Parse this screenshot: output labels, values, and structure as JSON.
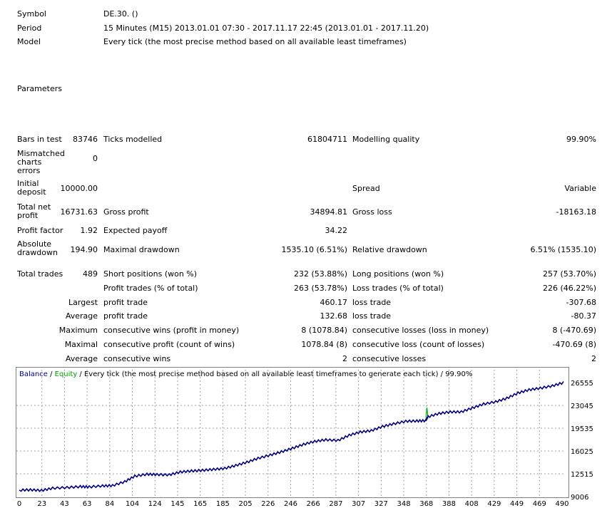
{
  "header": {
    "symbol_label": "Symbol",
    "symbol_value": "DE.30. ()",
    "period_label": "Period",
    "period_value": "15 Minutes (M15) 2013.01.01 07:30 - 2017.11.17 22:45 (2013.01.01 - 2017.11.20)",
    "model_label": "Model",
    "model_value": "Every tick (the most precise method based on all available least timeframes)",
    "parameters_label": "Parameters"
  },
  "stats": {
    "bars_label": "Bars in test",
    "bars_value": "83746",
    "ticks_label": "Ticks modelled",
    "ticks_value": "61804711",
    "quality_label": "Modelling quality",
    "quality_value": "99.90%",
    "mismatch_label": "Mismatched charts errors",
    "mismatch_value": "0",
    "deposit_label": "Initial deposit",
    "deposit_value": "10000.00",
    "spread_label": "Spread",
    "spread_value": "Variable",
    "netprofit_label": "Total net profit",
    "netprofit_value": "16731.63",
    "grossprofit_label": "Gross profit",
    "grossprofit_value": "34894.81",
    "grossloss_label": "Gross loss",
    "grossloss_value": "-18163.18",
    "pf_label": "Profit factor",
    "pf_value": "1.92",
    "payoff_label": "Expected payoff",
    "payoff_value": "34.22",
    "absdd_label": "Absolute drawdown",
    "absdd_value": "194.90",
    "maxdd_label": "Maximal drawdown",
    "maxdd_value": "1535.10 (6.51%)",
    "reldd_label": "Relative drawdown",
    "reldd_value": "6.51% (1535.10)",
    "trades_label": "Total trades",
    "trades_value": "489",
    "short_label": "Short positions (won %)",
    "short_value": "232 (53.88%)",
    "long_label": "Long positions (won %)",
    "long_value": "257 (53.70%)",
    "ptrades_label": "Profit trades (% of total)",
    "ptrades_value": "263 (53.78%)",
    "ltrades_label": "Loss trades (% of total)",
    "ltrades_value": "226 (46.22%)",
    "largest_label": "Largest",
    "largest_p_label": "profit trade",
    "largest_p_value": "460.17",
    "largest_l_label": "loss trade",
    "largest_l_value": "-307.68",
    "average_label": "Average",
    "average_p_label": "profit trade",
    "average_p_value": "132.68",
    "average_l_label": "loss trade",
    "average_l_value": "-80.37",
    "maximum_label": "Maximum",
    "maxwins_label": "consecutive wins (profit in money)",
    "maxwins_value": "8 (1078.84)",
    "maxlosses_label": "consecutive losses (loss in money)",
    "maxlosses_value": "8 (-470.69)",
    "maximal_label": "Maximal",
    "maxprofit_label": "consecutive profit (count of wins)",
    "maxprofit_value": "1078.84 (8)",
    "maxloss_label": "consecutive loss (count of losses)",
    "maxloss_value": "-470.69 (8)",
    "avgcons_label": "Average",
    "avgwins_label": "consecutive wins",
    "avgwins_value": "2",
    "avglosses_label": "consecutive losses",
    "avglosses_value": "2"
  },
  "chart_legend": {
    "balance": "Balance",
    "slash": " / ",
    "equity": "Equity",
    "rest": " / Every tick (the most precise method based on all available least timeframes to generate each tick) / 99.90%",
    "balance_color": "#000080",
    "equity_color": "#00b000"
  },
  "chart_data": {
    "type": "line",
    "x_ticks": [
      "0",
      "23",
      "43",
      "63",
      "84",
      "104",
      "124",
      "145",
      "165",
      "185",
      "205",
      "226",
      "246",
      "266",
      "287",
      "307",
      "327",
      "348",
      "368",
      "388",
      "408",
      "429",
      "449",
      "469",
      "490"
    ],
    "y_ticks": [
      "26555",
      "23045",
      "19535",
      "16025",
      "12515",
      "9006"
    ],
    "ylim": [
      9006,
      26555
    ],
    "xlim": [
      0,
      490
    ],
    "series": [
      {
        "name": "Balance",
        "values": [
          [
            0,
            10000
          ],
          [
            10,
            10050
          ],
          [
            20,
            9950
          ],
          [
            30,
            10300
          ],
          [
            43,
            10400
          ],
          [
            55,
            10550
          ],
          [
            63,
            10500
          ],
          [
            75,
            10650
          ],
          [
            84,
            10700
          ],
          [
            95,
            11300
          ],
          [
            104,
            12150
          ],
          [
            115,
            12450
          ],
          [
            124,
            12400
          ],
          [
            135,
            12350
          ],
          [
            145,
            12800
          ],
          [
            155,
            12950
          ],
          [
            165,
            13050
          ],
          [
            175,
            13200
          ],
          [
            185,
            13350
          ],
          [
            195,
            13800
          ],
          [
            205,
            14300
          ],
          [
            215,
            14900
          ],
          [
            226,
            15400
          ],
          [
            236,
            15900
          ],
          [
            246,
            16450
          ],
          [
            256,
            17050
          ],
          [
            266,
            17500
          ],
          [
            276,
            17750
          ],
          [
            287,
            17650
          ],
          [
            297,
            18450
          ],
          [
            307,
            18950
          ],
          [
            317,
            19150
          ],
          [
            327,
            19800
          ],
          [
            337,
            20200
          ],
          [
            348,
            20600
          ],
          [
            358,
            20650
          ],
          [
            366,
            20700
          ],
          [
            368,
            21300
          ],
          [
            378,
            21800
          ],
          [
            388,
            22050
          ],
          [
            398,
            22050
          ],
          [
            408,
            22650
          ],
          [
            418,
            23250
          ],
          [
            429,
            23600
          ],
          [
            439,
            24150
          ],
          [
            449,
            24950
          ],
          [
            459,
            25450
          ],
          [
            469,
            25700
          ],
          [
            480,
            26050
          ],
          [
            490,
            26555
          ]
        ]
      },
      {
        "name": "Equity",
        "values": [
          [
            366,
            20700
          ],
          [
            367,
            22700
          ],
          [
            368,
            21300
          ]
        ]
      }
    ]
  }
}
